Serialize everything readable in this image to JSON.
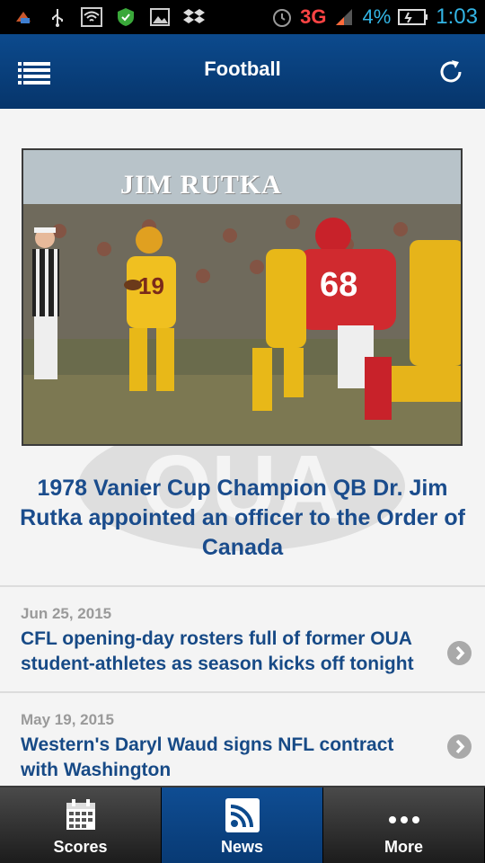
{
  "status_bar": {
    "network": "3G",
    "battery": "4%",
    "time": "1:03"
  },
  "header": {
    "title": "Football"
  },
  "featured": {
    "image_caption": "JIM RUTKA",
    "watermark": "OUA",
    "headline": "1978 Vanier Cup Champion QB Dr. Jim Rutka appointed an officer to the Order of Canada"
  },
  "news": [
    {
      "date": "Jun 25, 2015",
      "title": "CFL opening-day rosters full of former OUA student-athletes as season kicks off tonight"
    },
    {
      "date": "May 19, 2015",
      "title": "Western's Daryl Waud signs NFL contract with Washington"
    }
  ],
  "tabs": [
    {
      "label": "Scores",
      "icon": "calendar-icon"
    },
    {
      "label": "News",
      "icon": "rss-icon"
    },
    {
      "label": "More",
      "icon": "more-dots-icon"
    }
  ]
}
